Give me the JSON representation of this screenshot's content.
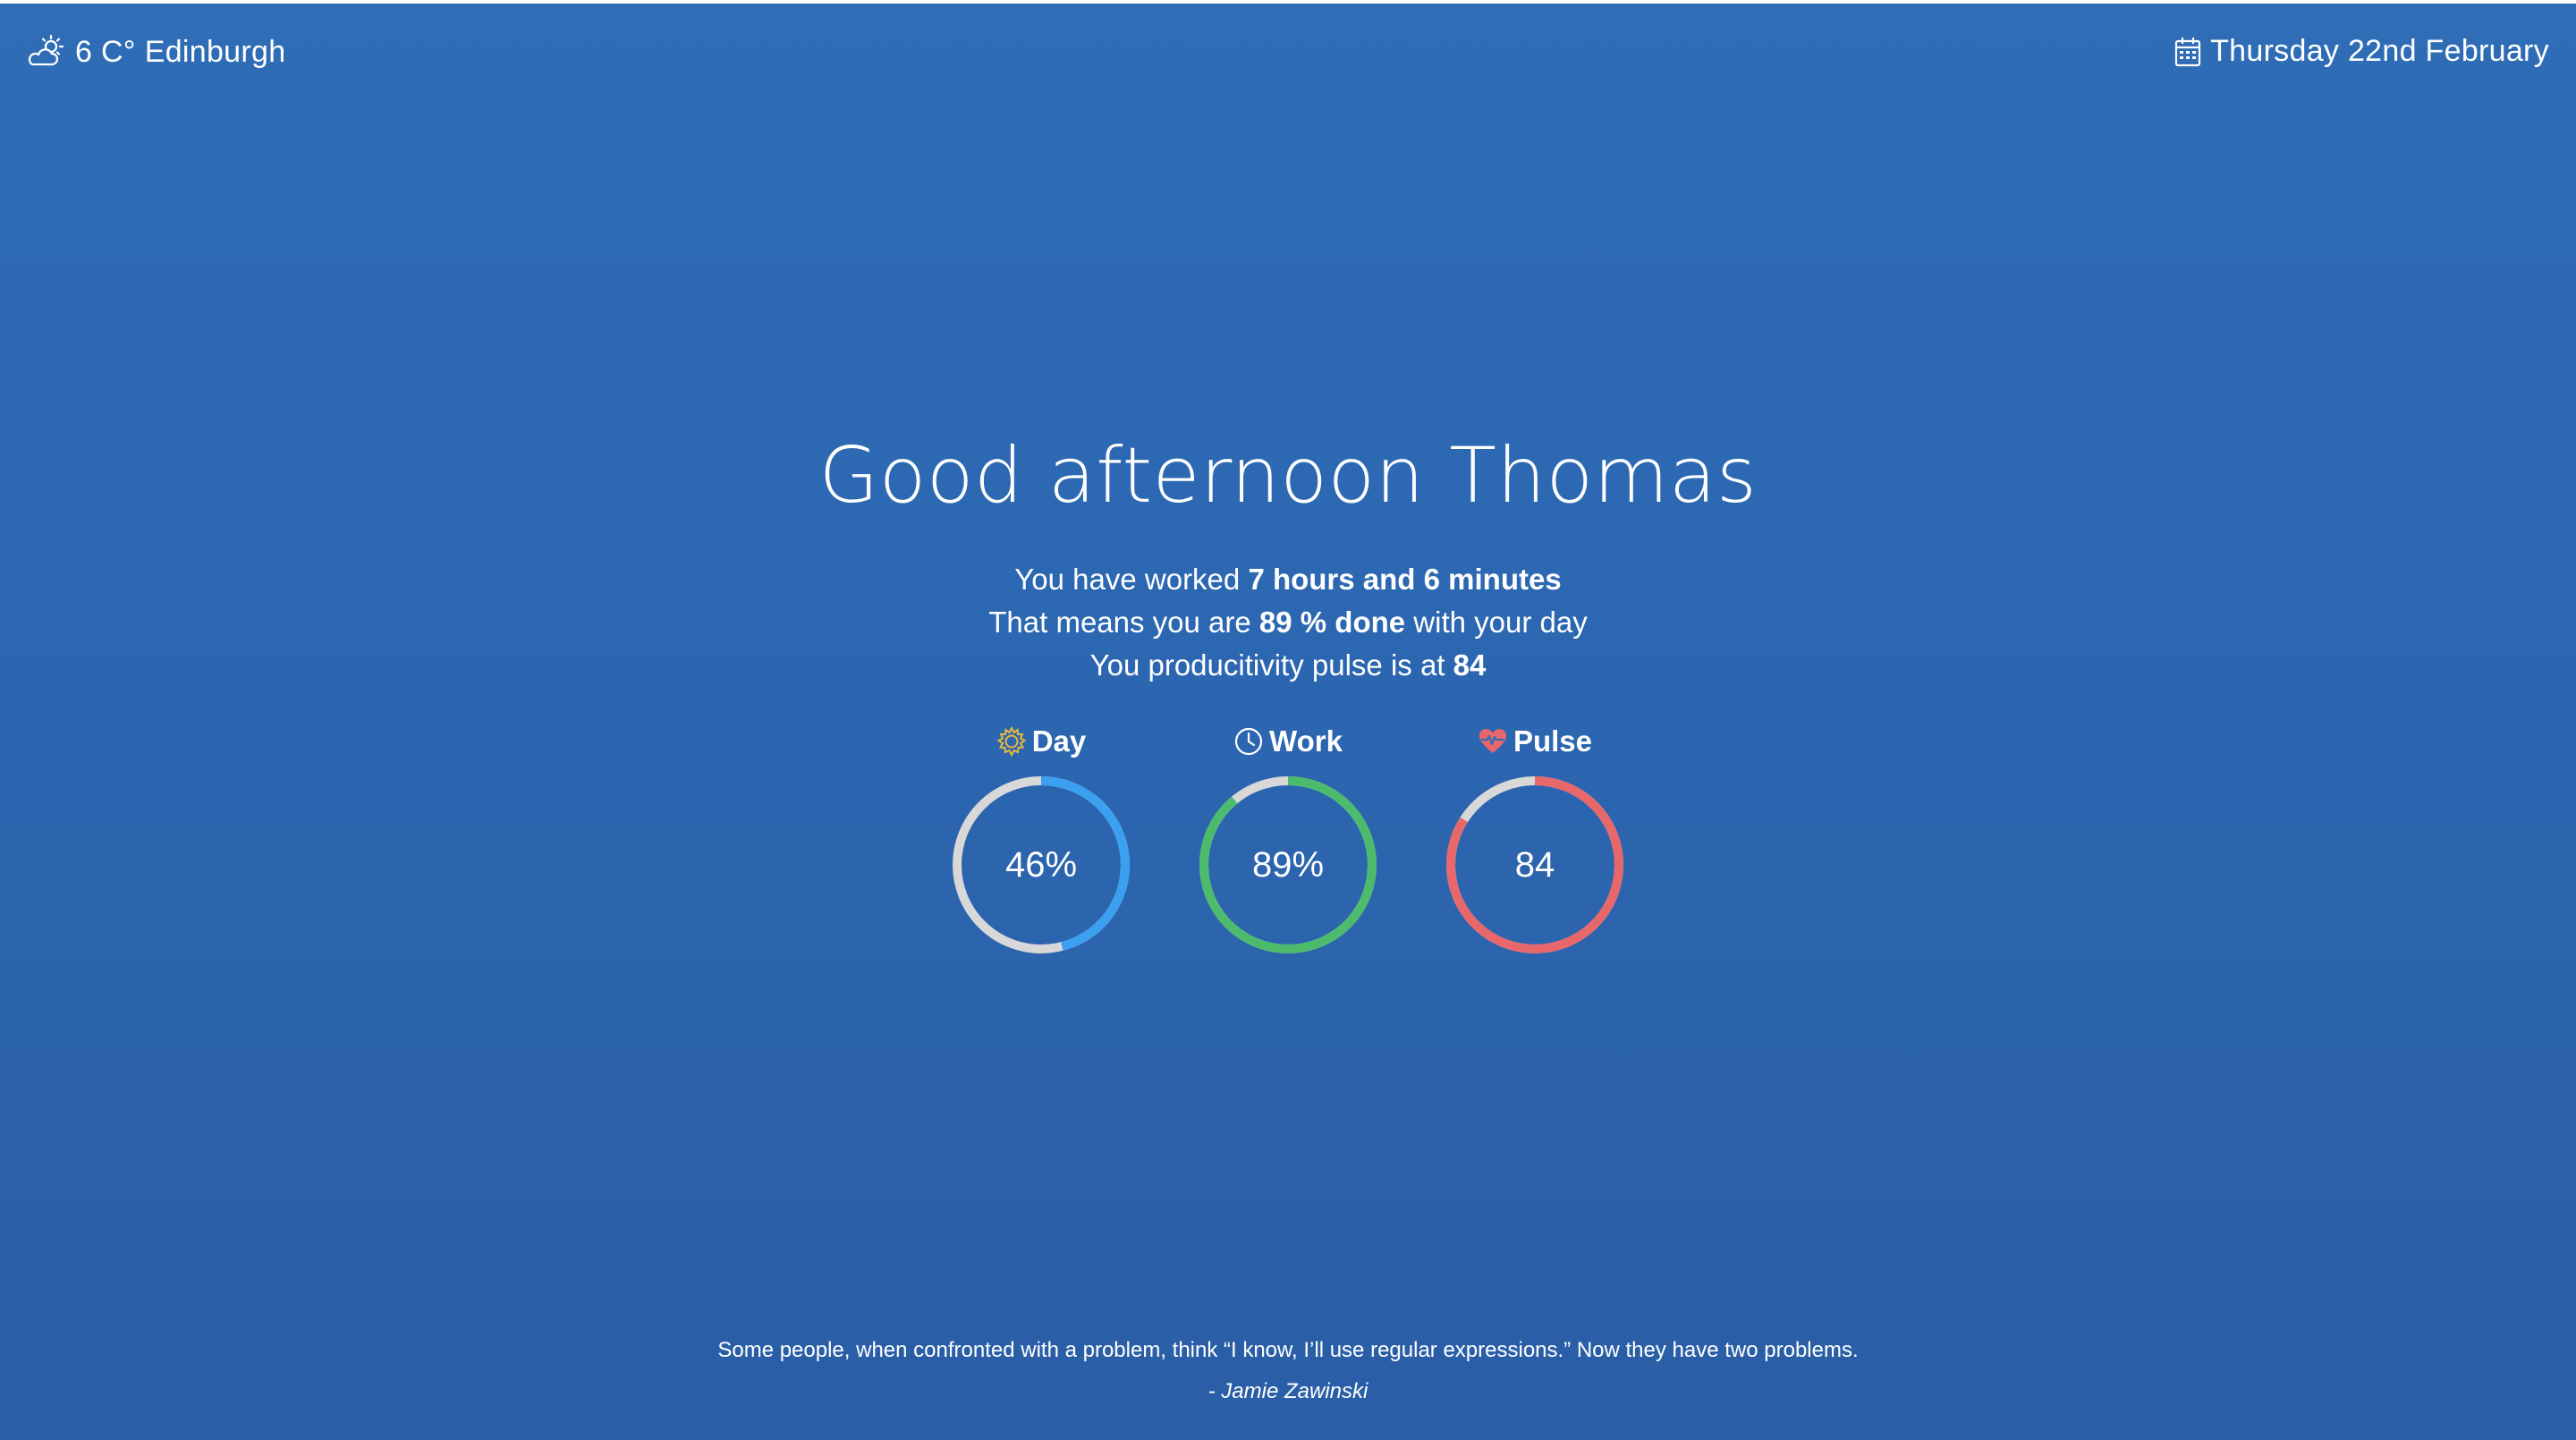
{
  "weather": {
    "icon": "partly-cloudy-icon",
    "temperature": "6 C°",
    "city": "Edinburgh"
  },
  "date": {
    "icon": "calendar-icon",
    "text": "Thursday 22nd February"
  },
  "greeting": "Good afternoon Thomas",
  "summary": {
    "line1_prefix": "You have worked ",
    "line1_value": "7 hours and 6 minutes",
    "line2_prefix": "That means you are ",
    "line2_value": "89 % done",
    "line2_suffix": " with your day",
    "line3_prefix": "You producitivity pulse is at ",
    "line3_value": "84"
  },
  "gauges": [
    {
      "label": "Day",
      "icon": "sun-icon",
      "value_text": "46%",
      "fraction": 0.46,
      "color": "#3aa0ef",
      "icon_color": "#e9b93a"
    },
    {
      "label": "Work",
      "icon": "clock-icon",
      "value_text": "89%",
      "fraction": 0.89,
      "color": "#4cbb6c",
      "icon_color": "#ffffff"
    },
    {
      "label": "Pulse",
      "icon": "heartbeat-icon",
      "value_text": "84",
      "fraction": 0.84,
      "color": "#e8676a",
      "icon_color": "#e8676a"
    }
  ],
  "track_color": "#d8d8d8",
  "quote": {
    "text": "Some people, when confronted with a problem, think “I know, I’ll use regular expressions.” Now they have two problems.",
    "author": "- Jamie Zawinski"
  }
}
